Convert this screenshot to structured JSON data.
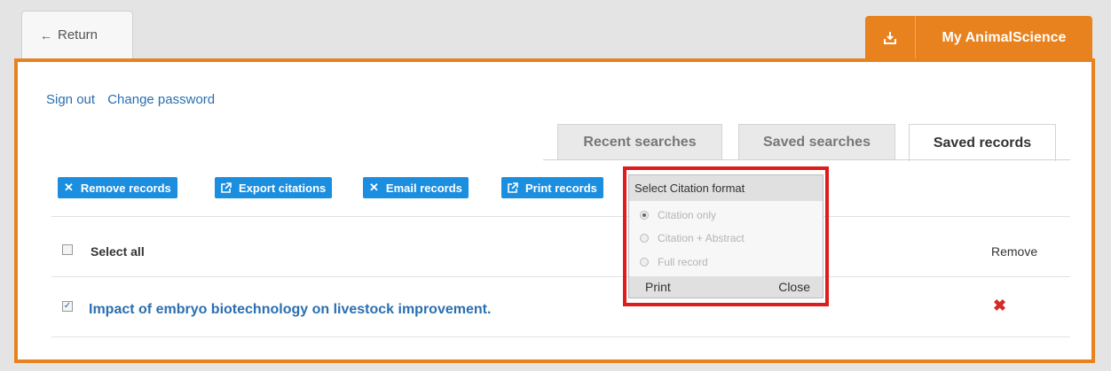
{
  "header": {
    "return_label": "Return",
    "my_area_title": "My AnimalScience",
    "download_icon": "download-icon"
  },
  "account": {
    "sign_out": "Sign out",
    "change_password": "Change password"
  },
  "tabs": [
    {
      "label": "Recent searches",
      "active": false
    },
    {
      "label": "Saved searches",
      "active": false
    },
    {
      "label": "Saved records",
      "active": true
    }
  ],
  "actions": {
    "remove_records": "Remove records",
    "export_citations": "Export citations",
    "email_records": "Email records",
    "print_records": "Print records"
  },
  "table": {
    "select_all": "Select all",
    "remove_header": "Remove",
    "records": [
      {
        "title": "Impact of embryo biotechnology on livestock improvement.",
        "checked": true
      }
    ]
  },
  "citation_popup": {
    "title": "Select Citation format",
    "options": [
      {
        "label": "Citation only",
        "selected": true
      },
      {
        "label": "Citation + Abstract",
        "selected": false
      },
      {
        "label": "Full record",
        "selected": false
      }
    ],
    "print_label": "Print",
    "close_label": "Close"
  },
  "colors": {
    "accent_orange": "#e8821e",
    "button_blue": "#1b8ee0",
    "link_blue": "#2a6fb0",
    "highlight_red": "#e01b1b"
  }
}
